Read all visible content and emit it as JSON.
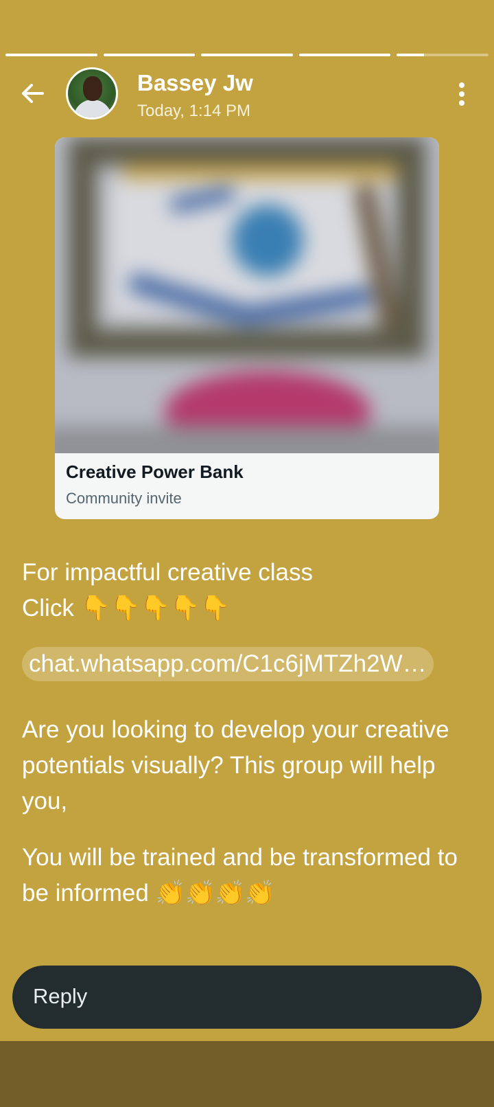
{
  "status": {
    "segments_progress": [
      1,
      1,
      1,
      1,
      0.3
    ]
  },
  "header": {
    "contact_name": "Bassey Jw",
    "timestamp": "Today, 1:14 PM"
  },
  "link_card": {
    "title": "Creative Power Bank",
    "subtitle": "Community invite"
  },
  "caption": {
    "line1": "For impactful creative class",
    "line2": "Click 👇👇👇👇👇",
    "link": "chat.whatsapp.com/C1c6jMTZh2W…",
    "para2": "Are you looking to develop your creative potentials visually? This group will help you,",
    "para3": "You will be trained and be transformed to be informed 👏👏👏👏"
  },
  "reply": {
    "label": "Reply"
  },
  "colors": {
    "background": "#c3a340",
    "reply_bar": "#232d2f",
    "bottom_band": "#735e29"
  }
}
